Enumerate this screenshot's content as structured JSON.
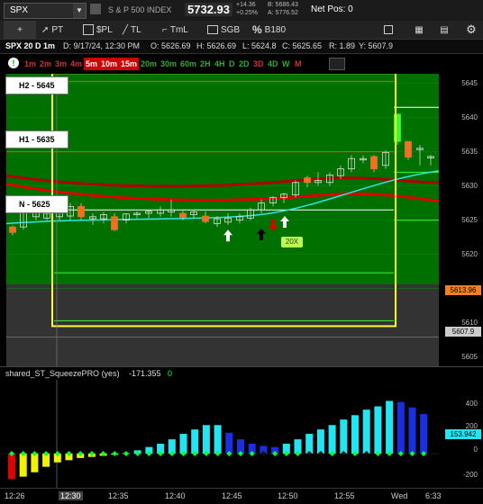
{
  "header": {
    "symbol": "SPX",
    "instrument": "S & P 500 INDEX",
    "last_price": "5732.93",
    "change": "+14.36",
    "change_pct": "+0.25%",
    "bid": "B: 5686.43",
    "ask": "A: 5776.52",
    "net_pos": "Net Pos: 0"
  },
  "toolbar": {
    "pt_label": "PT",
    "pl_label": "$PL",
    "tl_label": "TL",
    "tml_label": "TmL",
    "sgb_label": "SGB",
    "b180_label": "B180"
  },
  "info": {
    "title": "SPX 20 D 1m",
    "date": "D: 9/17/24, 12:30 PM",
    "open": "O: 5626.69",
    "high": "H: 5626.69",
    "low": "L: 5624.8",
    "close": "C: 5625.65",
    "range": "R: 1.89",
    "y": "Y: 5607.9"
  },
  "timeframes": [
    {
      "label": "1m",
      "color": "#cc3333",
      "active": false
    },
    {
      "label": "2m",
      "color": "#cc3333",
      "active": false
    },
    {
      "label": "3m",
      "color": "#cc3333",
      "active": false
    },
    {
      "label": "4m",
      "color": "#cc3333",
      "active": false
    },
    {
      "label": "5m",
      "color": "#ff3b3b",
      "active": true
    },
    {
      "label": "10m",
      "color": "#ff3b3b",
      "active": true
    },
    {
      "label": "15m",
      "color": "#ff3b3b",
      "active": true
    },
    {
      "label": "20m",
      "color": "#33aa33",
      "active": false
    },
    {
      "label": "30m",
      "color": "#33aa33",
      "active": false
    },
    {
      "label": "60m",
      "color": "#33aa33",
      "active": false
    },
    {
      "label": "2H",
      "color": "#33aa33",
      "active": false
    },
    {
      "label": "4H",
      "color": "#33aa33",
      "active": false
    },
    {
      "label": "D",
      "color": "#33aa33",
      "active": false
    },
    {
      "label": "2D",
      "color": "#33aa33",
      "active": false
    },
    {
      "label": "3D",
      "color": "#cc3333",
      "active": false
    },
    {
      "label": "4D",
      "color": "#33aa33",
      "active": false
    },
    {
      "label": "W",
      "color": "#33aa33",
      "active": false
    },
    {
      "label": "M",
      "color": "#cc3333",
      "active": false
    }
  ],
  "levels": {
    "h2": "H2 - 5645",
    "h1": "H1 - 5635",
    "n": "N - 5625"
  },
  "price_axis": [
    "5645",
    "5640",
    "5635",
    "5630",
    "5625",
    "5620",
    "5615",
    "5610",
    "5605"
  ],
  "price_boxes": {
    "current": "5613.96",
    "prev": "5607.9"
  },
  "signal_label": "20X",
  "indicator": {
    "name": "shared_ST_SqueezePRO (yes)",
    "value": "-171.355",
    "value2": "0",
    "axis": [
      "400",
      "200",
      "0",
      "-200"
    ],
    "current_box": "153.942",
    "histogram": [
      -230,
      -210,
      -170,
      -120,
      -80,
      -60,
      -40,
      -30,
      -20,
      -10,
      5,
      30,
      60,
      90,
      130,
      180,
      220,
      260,
      260,
      190,
      130,
      90,
      70,
      60,
      90,
      130,
      180,
      220,
      260,
      310,
      350,
      400,
      430,
      480,
      470,
      420,
      360
    ]
  },
  "time_axis": [
    "12:26",
    "12:30",
    "12:35",
    "12:40",
    "12:45",
    "12:50",
    "12:55",
    "Wed",
    "6:33"
  ],
  "colors": {
    "green_bg": "#007000",
    "histogram_cyan": "#22e5f2",
    "histogram_blue": "#1a2fe0",
    "histogram_red": "#e00000",
    "histogram_yellow": "#f2f200",
    "squeeze_dot": "#00ff33",
    "yellow_box": "#ffff33"
  }
}
